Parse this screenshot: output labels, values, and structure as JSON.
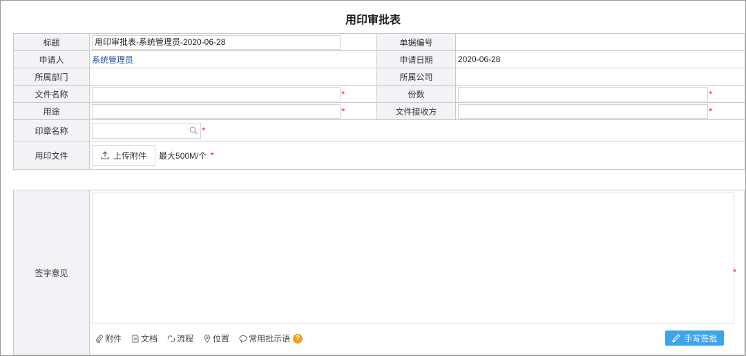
{
  "form": {
    "title": "用印审批表",
    "rows": {
      "title_label": "标题",
      "title_value": "用印审批表-系统管理员-2020-06-28",
      "doc_no_label": "单据编号",
      "doc_no_value": "",
      "applicant_label": "申请人",
      "applicant_value": "系统管理员",
      "apply_date_label": "申请日期",
      "apply_date_value": "2020-06-28",
      "dept_label": "所属部门",
      "dept_value": "",
      "company_label": "所属公司",
      "company_value": "",
      "file_name_label": "文件名称",
      "copies_label": "份数",
      "purpose_label": "用途",
      "receiver_label": "文件接收方",
      "seal_name_label": "印章名称",
      "seal_file_label": "用印文件",
      "upload_label": "上传附件",
      "upload_limit": "最大500M/个"
    },
    "required_mark": "*"
  },
  "opinion": {
    "label": "签字意见",
    "toolbar": {
      "attach": "附件",
      "document": "文档",
      "flow": "流程",
      "location": "位置",
      "common_phrases": "常用批示语",
      "help": "?"
    },
    "sign_button": "手写签批"
  },
  "icons": {
    "search": "search-icon",
    "upload": "upload-icon",
    "paperclip": "paperclip-icon",
    "doc": "document-icon",
    "flow": "flow-icon",
    "location": "location-pin-icon",
    "chat": "chat-bubble-icon",
    "pen": "pen-icon"
  },
  "colors": {
    "required": "#e8383d",
    "link": "#1f4e9d",
    "label_bg": "#f2f2f7",
    "sign_button": "#3fa3e8",
    "help": "#f0a020"
  }
}
